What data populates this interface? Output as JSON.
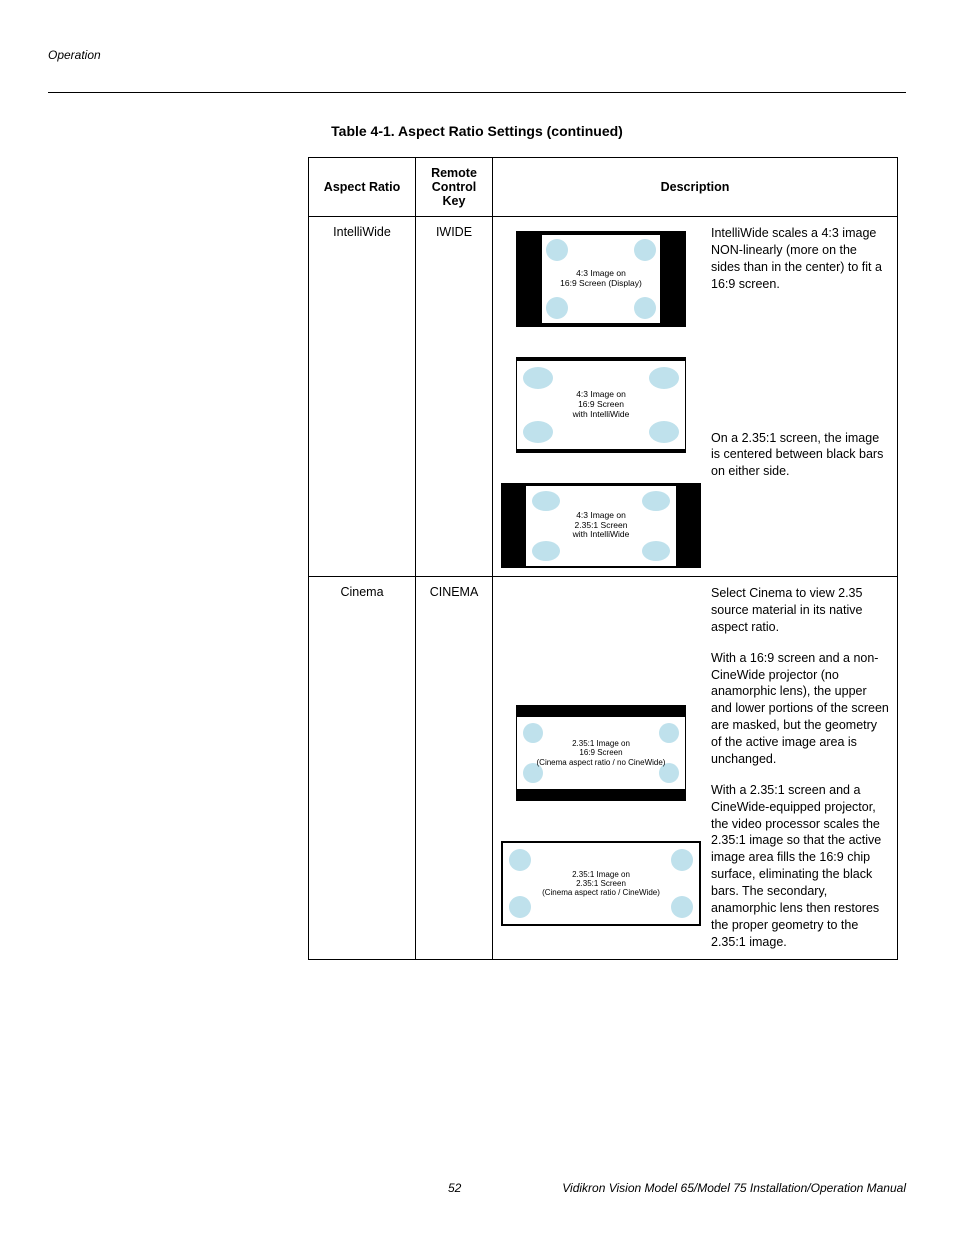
{
  "running_header": "Operation",
  "table_caption": "Table 4-1. Aspect Ratio Settings (continued)",
  "columns": {
    "aspect_ratio": "Aspect Ratio",
    "remote_key": "Remote Control Key",
    "description": "Description"
  },
  "rows": [
    {
      "aspect_ratio": "IntelliWide",
      "remote_key": "IWIDE",
      "diagrams": [
        {
          "label": "4:3 Image on\n16:9 Screen (Display)"
        },
        {
          "label": "4:3 Image on\n16:9 Screen\nwith IntelliWide"
        },
        {
          "label": "4:3 Image on\n2.35:1 Screen\nwith IntelliWide"
        }
      ],
      "desc": [
        "IntelliWide scales a 4:3 image NON-linearly (more on the sides than in the center) to fit a 16:9 screen.",
        "On a 2.35:1 screen, the image is centered between black bars on either side."
      ]
    },
    {
      "aspect_ratio": "Cinema",
      "remote_key": "CINEMA",
      "diagrams": [
        {
          "label": "2.35:1 Image on\n16:9 Screen\n(Cinema aspect ratio / no CineWide)"
        },
        {
          "label": "2.35:1 Image on\n2.35:1 Screen\n(Cinema aspect ratio / CineWide)"
        }
      ],
      "desc": [
        "Select Cinema to view 2.35 source material in its native aspect ratio.",
        "With a 16:9 screen and a non-CineWide projector (no anamorphic lens), the upper and lower portions of the screen are masked, but the geometry of the active image area is unchanged.",
        "With a 2.35:1 screen and a CineWide-equipped projector, the video processor scales the 2.35:1 image so that the active image area fills the 16:9 chip surface, eliminating the black bars. The secondary, anamorphic lens then restores the proper geometry to the 2.35:1 image."
      ]
    }
  ],
  "footer": {
    "page": "52",
    "manual_title": "Vidikron Vision Model 65/Model 75 Installation/Operation Manual"
  }
}
